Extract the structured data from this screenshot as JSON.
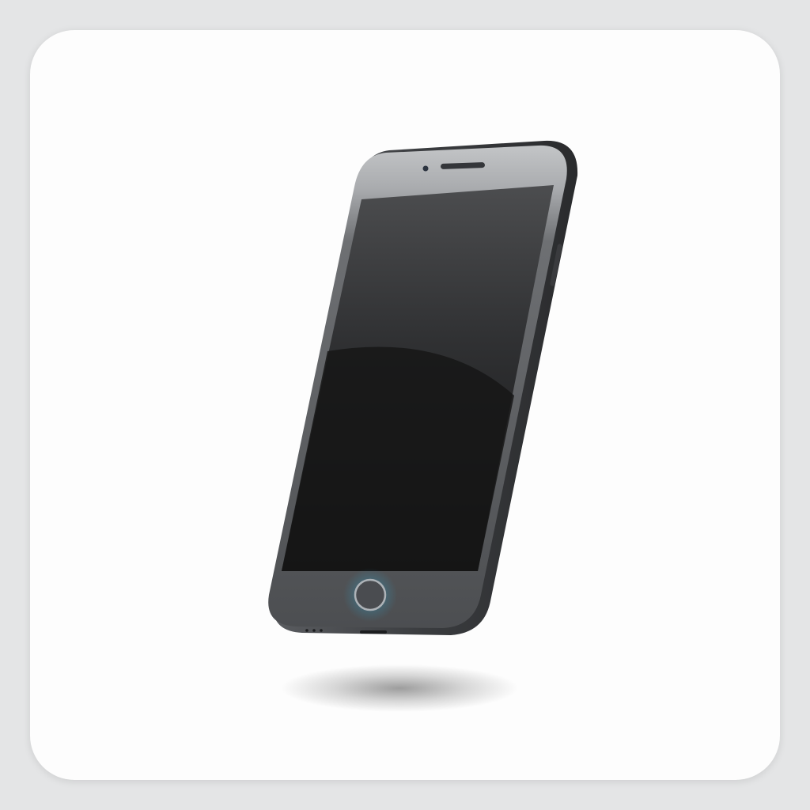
{
  "image": {
    "subject": "smartphone-icon"
  },
  "colors": {
    "page_background": "#e4e5e6",
    "card_background": "#fdfdfd",
    "phone_frame": "#4a4c4f",
    "phone_bezel_top": "#b9bbbd",
    "screen": "#151515",
    "home_button_glow": "#2bb7e8"
  }
}
